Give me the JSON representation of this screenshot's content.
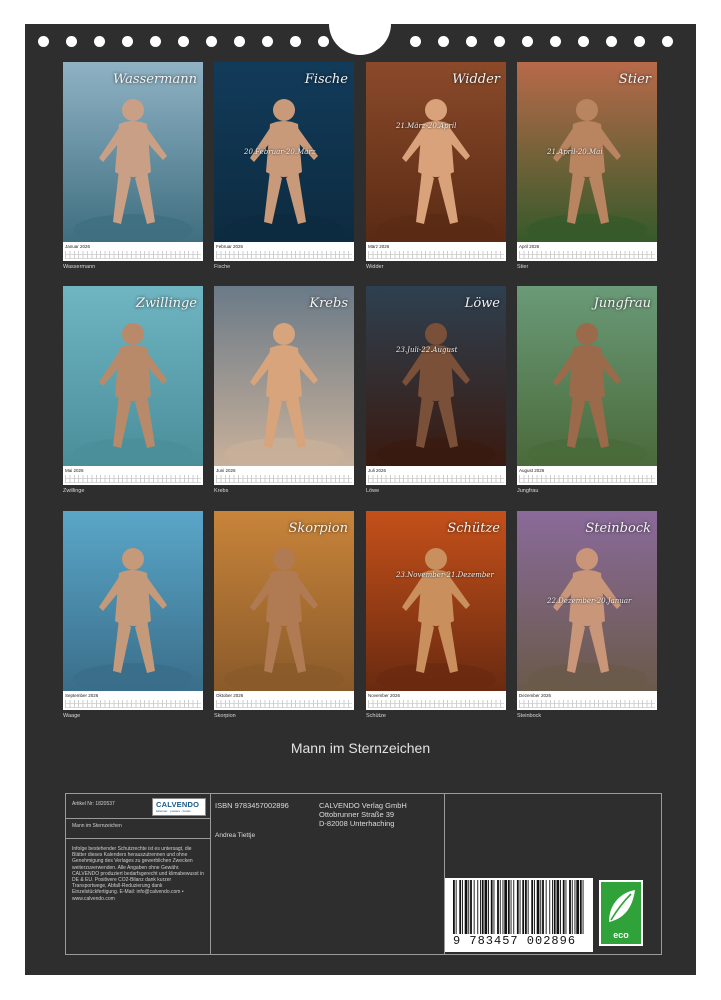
{
  "calendar": {
    "title": "Mann im Sternzeichen",
    "months": [
      {
        "label": "Januar 2026",
        "caption": "Wassermann",
        "photo_title": "Wassermann",
        "photo_date": "",
        "sky": "#8fb2c4",
        "ground": "#3f6f80",
        "skin": "#c9a085"
      },
      {
        "label": "Februar 2026",
        "caption": "Fische",
        "photo_title": "Fische",
        "photo_date": "20.Februar-20.März",
        "sky": "#123b5a",
        "ground": "#0d2b40",
        "skin": "#c99a7a"
      },
      {
        "label": "März 2026",
        "caption": "Widder",
        "photo_title": "Widder",
        "photo_date": "21.März-20.April",
        "sky": "#8a4a2a",
        "ground": "#5a2a14",
        "skin": "#d9a27a"
      },
      {
        "label": "April 2026",
        "caption": "Stier",
        "photo_title": "Stier",
        "photo_date": "21.April-20.Mai",
        "sky": "#b86a4a",
        "ground": "#365a2a",
        "skin": "#b98460"
      },
      {
        "label": "Mai 2026",
        "caption": "Zwillinge",
        "photo_title": "Zwillinge",
        "photo_date": "",
        "sky": "#6fb5c2",
        "ground": "#4a8e9a",
        "skin": "#b88a6a"
      },
      {
        "label": "Juni 2026",
        "caption": "Krebs",
        "photo_title": "Krebs",
        "photo_date": "",
        "sky": "#6a7a88",
        "ground": "#c8b09a",
        "skin": "#d7a47c"
      },
      {
        "label": "Juli 2026",
        "caption": "Löwe",
        "photo_title": "Löwe",
        "photo_date": "23.Juli-22.August",
        "sky": "#2e4050",
        "ground": "#3a1a10",
        "skin": "#7a5038"
      },
      {
        "label": "August 2026",
        "caption": "Jungfrau",
        "photo_title": "Jungfrau",
        "photo_date": "",
        "sky": "#6a9a78",
        "ground": "#4a6a3a",
        "skin": "#9a6a4a"
      },
      {
        "label": "September 2026",
        "caption": "Waage",
        "photo_title": "",
        "photo_date": "",
        "sky": "#5aa6c8",
        "ground": "#3a6e8a",
        "skin": "#c49a7a"
      },
      {
        "label": "Oktober 2026",
        "caption": "Skorpion",
        "photo_title": "Skorpion",
        "photo_date": "",
        "sky": "#c8843a",
        "ground": "#8a5a2a",
        "skin": "#b07a52"
      },
      {
        "label": "November 2026",
        "caption": "Schütze",
        "photo_title": "Schütze",
        "photo_date": "23.November-21.Dezember",
        "sky": "#c4501a",
        "ground": "#6a2a10",
        "skin": "#c9905e"
      },
      {
        "label": "Dezember 2026",
        "caption": "Steinbock",
        "photo_title": "Steinbock",
        "photo_date": "22.Dezember-20.Januar",
        "sky": "#8a6a9a",
        "ground": "#6a5a4a",
        "skin": "#c9967a"
      }
    ]
  },
  "info": {
    "article_label": "Artikel Nr: 1820537",
    "product_title": "Mann im Sternzeichen",
    "logo": "CALVENDO",
    "logo_sub": "kalender · posters · books",
    "legal": "Infolge bestehender Schutzrechte ist es untersagt, die Blätter dieses Kalenders herauszutrennen und ohne Genehmigung des Verlages zu gewerblichen Zwecken weiterzuverwenden. Alle Angaben ohne Gewähr. CALVENDO produziert bedarfsgerecht und klimabewusst in DE & EU. Positivere CO2-Bilanz dank kurzer Transportwege, Abfall-Reduzierung dank Einzelstückfertigung. E-Mail: info@calvendo.com • www.calvendo.com",
    "isbn": "ISBN 9783457002896",
    "author": "Andrea Tiettje",
    "publisher_line1": "CALVENDO Verlag GmbH",
    "publisher_line2": "Ottobrunner Straße 39",
    "publisher_line3": "D-82008 Unterhaching",
    "barcode_number": "9   783457   002896",
    "eco_label": "eco"
  }
}
